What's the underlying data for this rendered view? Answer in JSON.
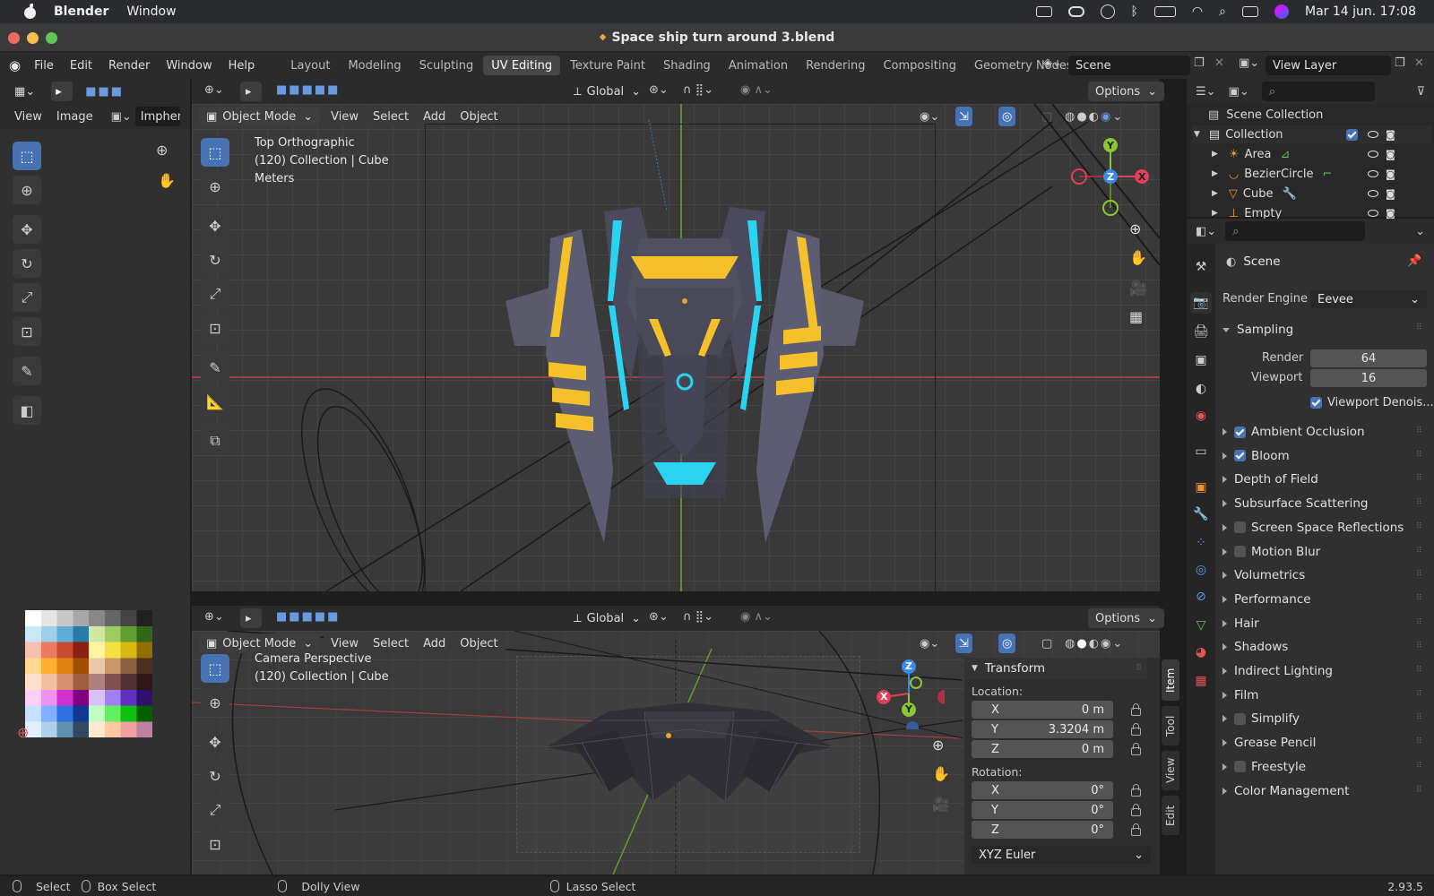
{
  "mac": {
    "app": "Blender",
    "menu": "Window",
    "clock": "Mar 14 jun. 17:08"
  },
  "window": {
    "title": "Space ship turn around 3.blend"
  },
  "topbar": {
    "menus": [
      "File",
      "Edit",
      "Render",
      "Window",
      "Help"
    ],
    "workspaces": [
      "Layout",
      "Modeling",
      "Sculpting",
      "UV Editing",
      "Texture Paint",
      "Shading",
      "Animation",
      "Rendering",
      "Compositing",
      "Geometry Nodes",
      "S"
    ],
    "scene": "Scene",
    "view_layer": "View Layer"
  },
  "uv_editor": {
    "view": "View",
    "image": "Image",
    "image_name": "Imphen"
  },
  "viewport_top": {
    "transform": "Global",
    "options": "Options",
    "mode": "Object Mode",
    "menus": [
      "View",
      "Select",
      "Add",
      "Object"
    ],
    "overlay": [
      "Top Orthographic",
      "(120) Collection | Cube",
      "Meters"
    ]
  },
  "viewport_bottom": {
    "transform": "Global",
    "options": "Options",
    "mode": "Object Mode",
    "menus": [
      "View",
      "Select",
      "Add",
      "Object"
    ],
    "overlay": [
      "Camera Perspective",
      "(120) Collection | Cube"
    ]
  },
  "gizmo": {
    "x": "X",
    "y": "Y",
    "z": "Z"
  },
  "outliner": {
    "root": "Scene Collection",
    "collection": "Collection",
    "items": [
      "Area",
      "BezierCircle",
      "Cube",
      "Empty"
    ]
  },
  "properties": {
    "title": "Scene",
    "render_engine_label": "Render Engine",
    "render_engine": "Eevee",
    "sampling": "Sampling",
    "render_label": "Render",
    "render_value": "64",
    "viewport_label": "Viewport",
    "viewport_value": "16",
    "denoise": "Viewport Denois...",
    "sections": [
      {
        "label": "Ambient Occlusion",
        "check": true
      },
      {
        "label": "Bloom",
        "check": true
      },
      {
        "label": "Depth of Field"
      },
      {
        "label": "Subsurface Scattering"
      },
      {
        "label": "Screen Space Reflections",
        "check": false
      },
      {
        "label": "Motion Blur",
        "check": false
      },
      {
        "label": "Volumetrics"
      },
      {
        "label": "Performance"
      },
      {
        "label": "Hair"
      },
      {
        "label": "Shadows"
      },
      {
        "label": "Indirect Lighting"
      },
      {
        "label": "Film"
      },
      {
        "label": "Simplify",
        "check": false
      },
      {
        "label": "Grease Pencil"
      },
      {
        "label": "Freestyle",
        "check": false
      },
      {
        "label": "Color Management"
      }
    ]
  },
  "npanel": {
    "title": "Transform",
    "location": "Location:",
    "loc": [
      {
        "axis": "X",
        "value": "0 m"
      },
      {
        "axis": "Y",
        "value": "3.3204 m"
      },
      {
        "axis": "Z",
        "value": "0 m"
      }
    ],
    "rotation": "Rotation:",
    "rot": [
      {
        "axis": "X",
        "value": "0°"
      },
      {
        "axis": "Y",
        "value": "0°"
      },
      {
        "axis": "Z",
        "value": "0°"
      }
    ],
    "euler": "XYZ Euler",
    "tabs": [
      "Item",
      "Tool",
      "View",
      "Edit"
    ]
  },
  "status": {
    "select": "Select",
    "box_select": "Box Select",
    "dolly": "Dolly View",
    "lasso": "Lasso Select",
    "version": "2.93.5"
  },
  "colors": {
    "accent": "#4772b3",
    "yellow_glow": "#f5c02a",
    "cyan_glow": "#2ad4f0"
  }
}
